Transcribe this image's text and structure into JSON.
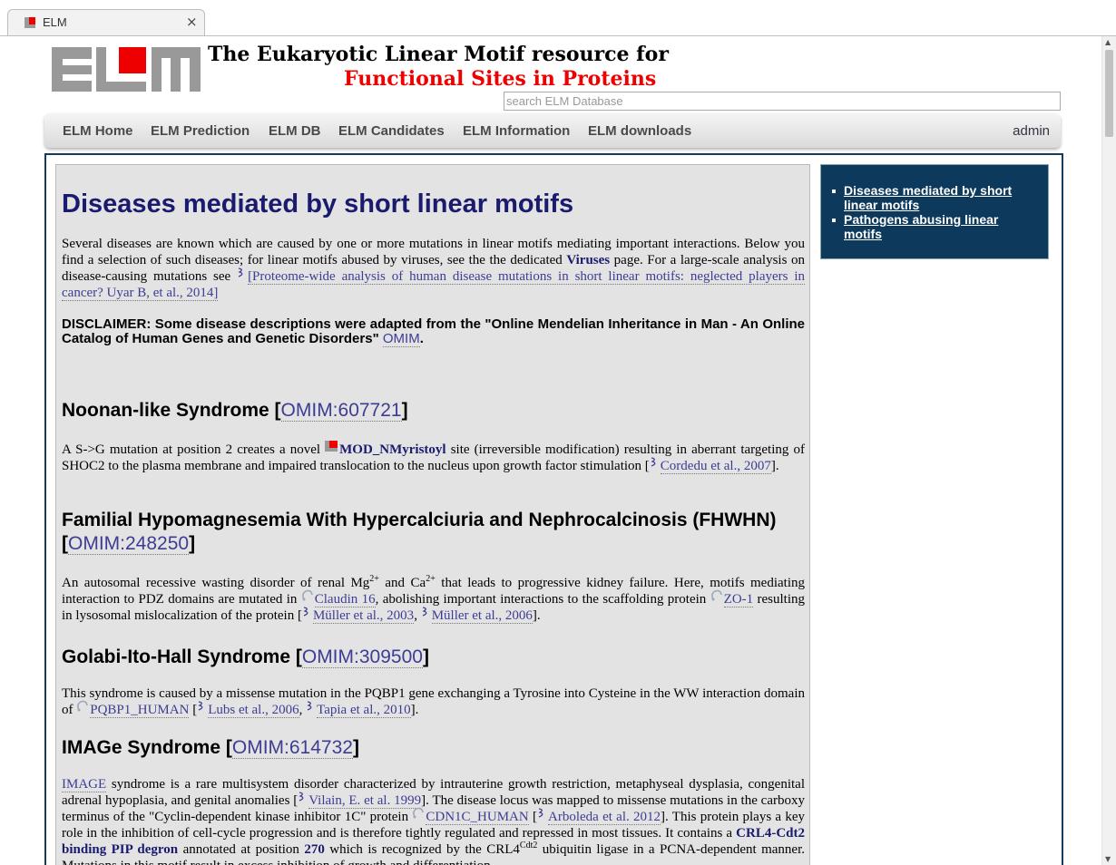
{
  "browser": {
    "tab_title": "ELM",
    "tab_close": "×"
  },
  "header": {
    "title_line1": "The Eukaryotic Linear Motif resource for",
    "title_line2": "Functional Sites in Proteins",
    "search_placeholder": "search ELM Database"
  },
  "nav": {
    "items": [
      "ELM Home",
      "ELM Prediction",
      "ELM DB",
      "ELM Candidates",
      "ELM Information",
      "ELM downloads"
    ],
    "admin": "admin"
  },
  "sidebar": {
    "links": [
      "Diseases mediated by short linear motifs",
      "Pathogens abusing linear motifs"
    ]
  },
  "page": {
    "heading": "Diseases mediated by short linear motifs",
    "intro_1": "Several diseases are known which are caused by one or more mutations in linear motifs mediating important interactions. Below you find a selection of such diseases; for linear motifs abused by viruses, see the the dedicated ",
    "intro_viruses": "Viruses",
    "intro_2": " page. For a large-scale analysis on disease-causing mutations see ",
    "intro_ref": "[Proteome-wide analysis of human disease mutations in short linear motifs: neglected players in cancer? Uyar B, et al., 2014]",
    "disclaimer": "DISCLAIMER: Some disease descriptions were adapted from the \"Online Mendelian Inheritance in Man - An Online Catalog of Human Genes and Genetic Disorders\" ",
    "disclaimer_link": "OMIM",
    "disclaimer_end": "."
  },
  "sections": {
    "noonan": {
      "title": "Noonan-like Syndrome [",
      "omim": "OMIM:607721",
      "close": "]",
      "t1": "A S->G mutation at position 2 creates a novel ",
      "motif": "MOD_NMyristoyl",
      "t2": " site (irreversible modification) resulting in aberrant targeting of SHOC2 to the plasma membrane and impaired translocation to the nucleus upon growth factor stimulation [",
      "ref1": "Cordedu et al., 2007",
      "t3": "]."
    },
    "fhhnc": {
      "title": "Familial Hypomagnesemia With Hypercalciuria and Nephrocalcinosis (FHWHN) [",
      "omim": "OMIM:248250",
      "close": "]",
      "t1": "An autosomal recessive wasting disorder of renal Mg",
      "sup1": "2+",
      "t2": " and Ca",
      "sup2": "2+",
      "t3": " that leads to progressive kidney failure. Here, motifs mediating interaction to PDZ domains are mutated in ",
      "prot1": "Claudin 16",
      "t4": ", abolishing important interactions to the scaffolding protein ",
      "prot2": "ZO-1",
      "t5": " resulting in lysosomal mislocalization of the protein [",
      "ref1": "Müller et al., 2003",
      "t6": ", ",
      "ref2": "Müller et al., 2006",
      "t7": "]."
    },
    "golabi": {
      "title": "Golabi-Ito-Hall Syndrome [",
      "omim": "OMIM:309500",
      "close": "]",
      "t1": "This syndrome is caused by a missense mutation in the PQBP1 gene exchanging a Tyrosine into Cysteine in the WW interaction domain of ",
      "prot1": "PQBP1_HUMAN",
      "t2": " [",
      "ref1": "Lubs et al., 2006",
      "t3": ", ",
      "ref2": "Tapia et al., 2010",
      "t4": "]."
    },
    "image": {
      "title": "IMAGe Syndrome [",
      "omim": "OMIM:614732",
      "close": "]",
      "link1": "IMAGE",
      "t1": " syndrome is a rare multisystem disorder characterized by intrauterine growth restriction, metaphyseal dysplasia, congenital adrenal hypoplasia, and genital anomalies [",
      "ref1": "Vilain, E. et al. 1999",
      "t2": "]. The disease locus was mapped to missense mutations in the carboxy terminus of the \"Cyclin-dependent kinase inhibitor 1C\" protein ",
      "prot1": "CDN1C_HUMAN",
      "t3": " [",
      "ref2": "Arboleda et al. 2012",
      "t4": "]. This protein plays a key role in the inhibition of cell-cycle progression and is therefore tightly regulated and repressed in most tissues. It contains a ",
      "motif": "CRL4-Cdt2 binding PIP degron",
      "t5": " annotated at position ",
      "position": "270",
      "t6": " which is recognized by the CRL4",
      "sup1": "Cdt2",
      "t7": " ubiquitin ligase in a PCNA-dependent manner. Mutations in this motif result in excess inhibition of growth and differentiation."
    }
  }
}
